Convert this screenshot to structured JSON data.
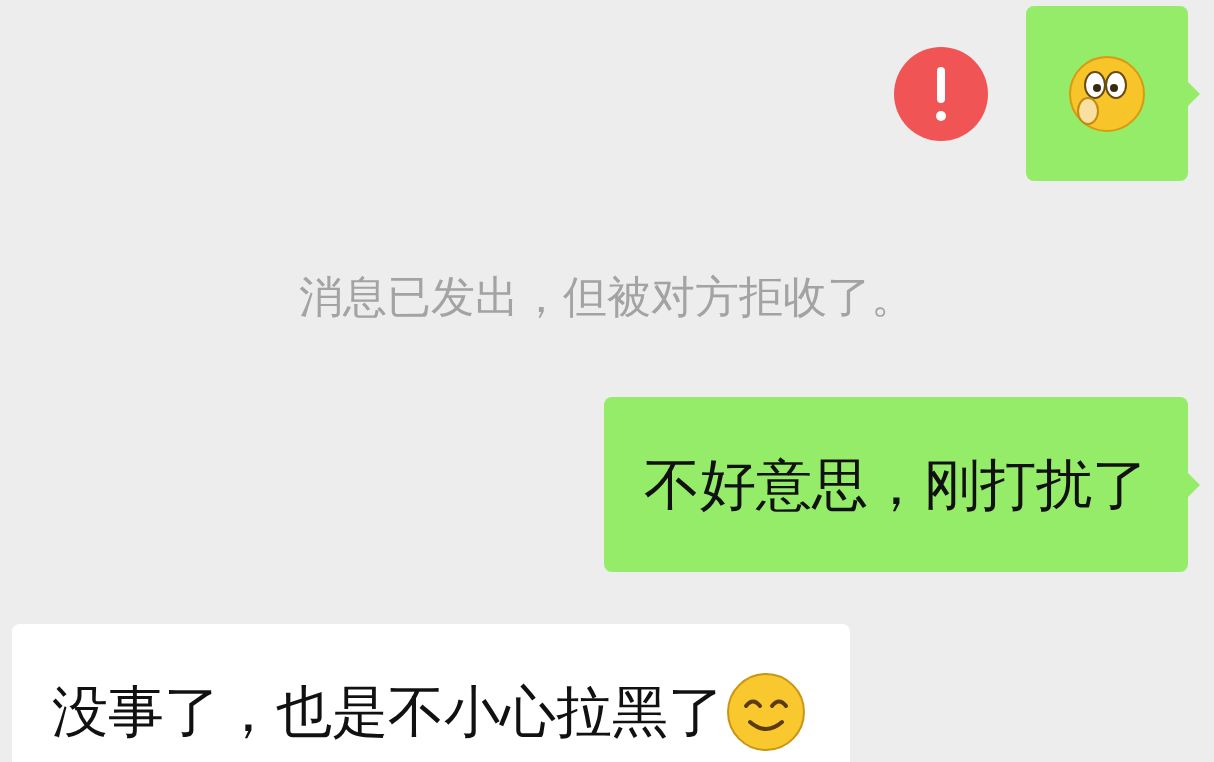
{
  "messages": [
    {
      "kind": "sticker",
      "outgoing": true,
      "failed": true
    },
    {
      "kind": "notice",
      "text": "消息已发出，但被对方拒收了。"
    },
    {
      "kind": "text",
      "outgoing": true,
      "failed": false,
      "text": "不好意思，刚打扰了",
      "trailing_emoji": false
    },
    {
      "kind": "text",
      "outgoing": false,
      "failed": false,
      "text": "没事了，也是不小心拉黑了",
      "trailing_emoji": true
    }
  ]
}
